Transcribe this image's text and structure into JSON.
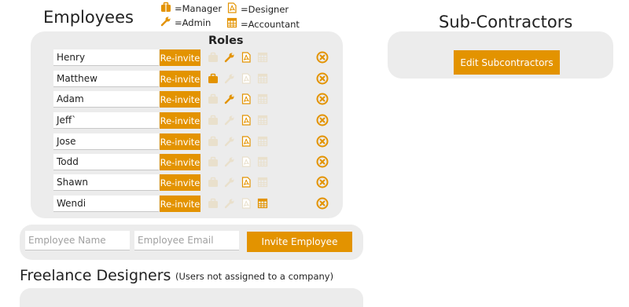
{
  "employees": {
    "title": "Employees",
    "roles_header": "Roles",
    "reinvite_label": "Re-invite",
    "legend": {
      "manager": "=Manager",
      "designer": "=Designer",
      "admin": "=Admin",
      "accountant": "=Accountant"
    },
    "rows": [
      {
        "name": "Henry",
        "roles": {
          "manager": false,
          "admin": true,
          "designer": true,
          "accountant": false
        }
      },
      {
        "name": "Matthew",
        "roles": {
          "manager": true,
          "admin": false,
          "designer": false,
          "accountant": false
        }
      },
      {
        "name": "Adam",
        "roles": {
          "manager": false,
          "admin": true,
          "designer": true,
          "accountant": false
        }
      },
      {
        "name": "Jeff`",
        "roles": {
          "manager": false,
          "admin": false,
          "designer": true,
          "accountant": false
        }
      },
      {
        "name": "Jose",
        "roles": {
          "manager": false,
          "admin": false,
          "designer": true,
          "accountant": false
        }
      },
      {
        "name": "Todd",
        "roles": {
          "manager": false,
          "admin": false,
          "designer": false,
          "accountant": false
        }
      },
      {
        "name": "Shawn",
        "roles": {
          "manager": false,
          "admin": false,
          "designer": true,
          "accountant": false
        }
      },
      {
        "name": "Wendi",
        "roles": {
          "manager": false,
          "admin": false,
          "designer": false,
          "accountant": true
        }
      }
    ],
    "invite_form": {
      "name_placeholder": "Employee Name",
      "email_placeholder": "Employee Email",
      "invite_button": "Invite Employee"
    }
  },
  "subcontractors": {
    "title": "Sub-Contractors",
    "edit_button": "Edit Subcontractors"
  },
  "freelance": {
    "title": "Freelance Designers",
    "subtitle": "(Users not assigned to a company)"
  },
  "colors": {
    "accent": "#e39300",
    "panel": "#ececec",
    "inactive_icon": "#e9e0cc"
  }
}
